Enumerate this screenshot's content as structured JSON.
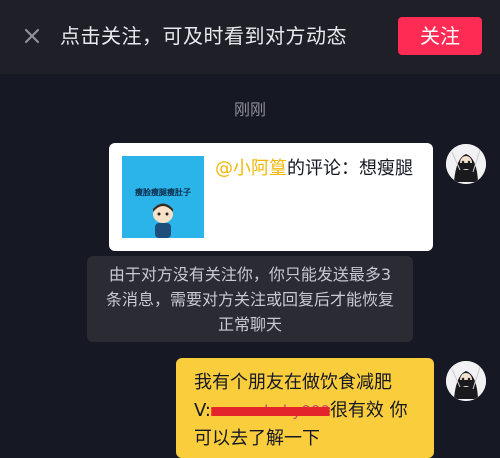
{
  "banner": {
    "prompt": "点击关注，可及时看到对方动态",
    "follow_label": "关注"
  },
  "timestamp": "刚刚",
  "comment_card": {
    "mention": "@小阿篁",
    "suffix": "的评论：想瘦腿",
    "thumbnail_caption": "瘦脸瘦腿瘦肚子"
  },
  "notice": {
    "text": "由于对方没有关注你，你只能发送最多3条消息，需要对方关注或回复后才能恢复正常聊天"
  },
  "message": {
    "line1": "我有个朋友在做饮食减肥",
    "line2_prefix": "V:",
    "line2_redacted": "xxxxxxbaby000",
    "line2_suffix": "很有效 你",
    "line3": "可以去了解一下"
  },
  "colors": {
    "background": "#161823",
    "banner_bg": "#1f1f27",
    "follow_button": "#fe2c55",
    "mention": "#f2b705",
    "bubble": "#facd3c",
    "redaction": "#e3242b"
  },
  "icons": {
    "close": "close-icon",
    "avatar": "avatar-image"
  }
}
